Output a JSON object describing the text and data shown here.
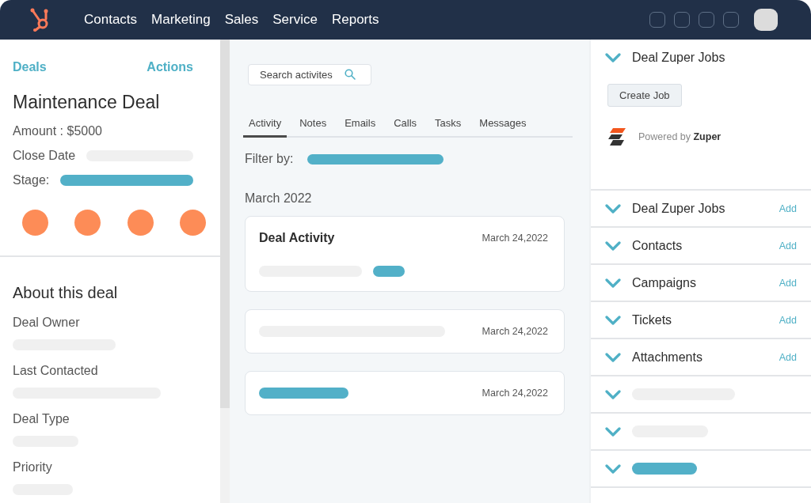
{
  "nav": {
    "items": [
      "Contacts",
      "Marketing",
      "Sales",
      "Service",
      "Reports"
    ]
  },
  "deal": {
    "back_link": "Deals",
    "actions_link": "Actions",
    "title": "Maintenance Deal",
    "amount": "Amount : $5000",
    "fields": [
      {
        "label": "Close Date",
        "color": "#f0f0f0"
      },
      {
        "label": "Stage:",
        "color": "#52b0c8"
      }
    ],
    "about_title": "About this deal",
    "properties": [
      {
        "label": "Deal Owner",
        "color": "#f0f0f0"
      },
      {
        "label": "Last Contacted",
        "color": "#f0f0f0"
      },
      {
        "label": "Deal Type",
        "color": "#f0f0f0"
      },
      {
        "label": "Priority",
        "color": "#f0f0f0"
      }
    ]
  },
  "activity": {
    "search": {
      "placeholder": "Search activites"
    },
    "tabs": [
      {
        "label": "Activity",
        "selected": true
      },
      {
        "label": "Notes",
        "selected": false
      },
      {
        "label": "Emails",
        "selected": false
      },
      {
        "label": "Calls",
        "selected": false
      },
      {
        "label": "Tasks",
        "selected": false
      },
      {
        "label": "Messages",
        "selected": false
      }
    ],
    "filter_label": "Filter by:",
    "month": "March 2022",
    "cards": [
      {
        "title": "Deal Activity",
        "date": "March 24,2022",
        "bars": [
          {
            "color": "#f0f0f0"
          },
          {
            "color": "#52b0c8"
          }
        ]
      },
      {
        "date": "March 24,2022",
        "bars": [
          {
            "color": "#f0f0f0"
          }
        ]
      },
      {
        "date": "March 24,2022",
        "bars": [
          {
            "color": "#52b0c8"
          }
        ]
      }
    ]
  },
  "sidebar": {
    "expanded": {
      "title": "Deal Zuper Jobs",
      "button": "Create Job",
      "powered_by": "Powered by **Zuper**"
    },
    "sections": [
      {
        "kind": "labeled",
        "label": "Deal Zuper Jobs",
        "action": "Add"
      },
      {
        "kind": "labeled",
        "label": "Contacts",
        "action": "Add"
      },
      {
        "kind": "labeled",
        "label": "Campaigns",
        "action": "Add"
      },
      {
        "kind": "labeled",
        "label": "Tickets",
        "action": "Add"
      },
      {
        "kind": "labeled",
        "label": "Attachments",
        "action": "Add"
      },
      {
        "kind": "skeleton",
        "color": "#f0f0f0"
      },
      {
        "kind": "skeleton",
        "color": "#f0f0f0"
      },
      {
        "kind": "skeleton",
        "color": "#52b0c8"
      }
    ]
  }
}
